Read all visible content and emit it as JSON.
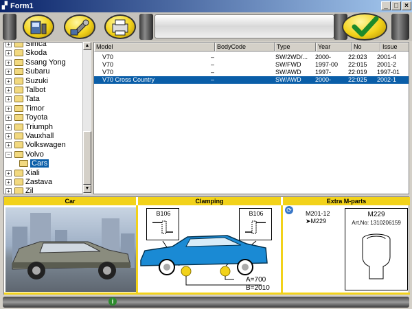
{
  "window": {
    "title": "Form1",
    "icon": "app-icon"
  },
  "window_controls": [
    "_",
    "□",
    "×"
  ],
  "toolbar": {
    "buttons": [
      "vehicle-lift-icon",
      "service-tool-icon",
      "printer-icon"
    ],
    "confirm_icon": "checkmark-icon"
  },
  "tree": {
    "items": [
      {
        "label": "Simca",
        "expanded": false
      },
      {
        "label": "Skoda",
        "expanded": false
      },
      {
        "label": "Ssang Yong",
        "expanded": false
      },
      {
        "label": "Subaru",
        "expanded": false
      },
      {
        "label": "Suzuki",
        "expanded": false
      },
      {
        "label": "Talbot",
        "expanded": false
      },
      {
        "label": "Tata",
        "expanded": false
      },
      {
        "label": "Timor",
        "expanded": false
      },
      {
        "label": "Toyota",
        "expanded": false
      },
      {
        "label": "Triumph",
        "expanded": false
      },
      {
        "label": "Vauxhall",
        "expanded": false
      },
      {
        "label": "Volkswagen",
        "expanded": false
      },
      {
        "label": "Volvo",
        "expanded": true
      },
      {
        "label": "Cars",
        "child": true,
        "selected": true
      },
      {
        "label": "Xiali",
        "expanded": false
      },
      {
        "label": "Zastava",
        "expanded": false
      },
      {
        "label": "Zil",
        "expanded": false
      }
    ]
  },
  "grid": {
    "columns": [
      "Model",
      "BodyCode",
      "Type",
      "Year",
      "No",
      "Issue"
    ],
    "rows": [
      {
        "model": "V70",
        "body": "–",
        "type": "SW/2WD/...",
        "year": "2000-",
        "no": "22:023",
        "issue": "2001-4",
        "selected": false
      },
      {
        "model": "V70",
        "body": "–",
        "type": "SW/FWD",
        "year": "1997-00",
        "no": "22:015",
        "issue": "2001-2",
        "selected": false
      },
      {
        "model": "V70",
        "body": "–",
        "type": "SW/AWD",
        "year": "1997-",
        "no": "22:019",
        "issue": "1997-01",
        "selected": false
      },
      {
        "model": "V70 Cross Country",
        "body": "–",
        "type": "SW/AWD",
        "year": "2000-",
        "no": "22:025",
        "issue": "2002-1",
        "selected": true
      }
    ]
  },
  "panels": {
    "car": {
      "header": "Car"
    },
    "clamping": {
      "header": "Clamping",
      "front_label": "B106",
      "rear_label": "B106",
      "dim_a": "A=700",
      "dim_b": "B=2010"
    },
    "extra": {
      "header": "Extra M-parts",
      "part_a": "M201-12",
      "part_b": "➤M229",
      "box_title": "M229",
      "art_no": "Art.No: 1310206159"
    }
  },
  "colors": {
    "accent_yellow": "#f2d21a",
    "selection_blue": "#0a5ea8",
    "car_blue": "#1a8ad4"
  },
  "statusbar": {
    "icon": "info-icon"
  }
}
